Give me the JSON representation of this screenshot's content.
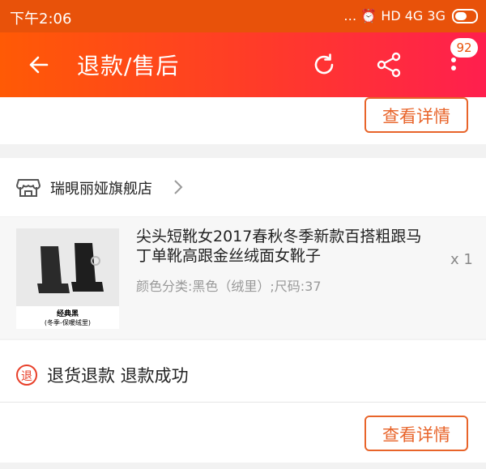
{
  "status_bar": {
    "time": "下午2:06",
    "indicators": "… ⏰ HD 4G 3G"
  },
  "appbar": {
    "title": "退款/售后",
    "badge_count": "92",
    "icons": [
      "back-arrow-icon",
      "refresh-icon",
      "share-icon",
      "more-vert-icon"
    ]
  },
  "top_order": {
    "detail_button": "查看详情"
  },
  "order": {
    "store_name": "瑞晛丽娅旗舰店",
    "product": {
      "title": "尖头短靴女2017春秋冬季新款百搭粗跟马丁单靴高跟金丝绒面女靴子",
      "spec": "颜色分类:黑色（绒里）;尺码:37",
      "quantity": "x 1",
      "image_label_main": "经典黑",
      "image_label_sub": "(冬季-保暖绒里)"
    },
    "refund_icon_char": "退",
    "status_text": "退货退款 退款成功",
    "detail_button": "查看详情"
  },
  "colors": {
    "status_bar": "#e8520a",
    "accent": "#e8642a",
    "gradient_start": "#ff5a05",
    "gradient_end": "#ff1f4e"
  }
}
